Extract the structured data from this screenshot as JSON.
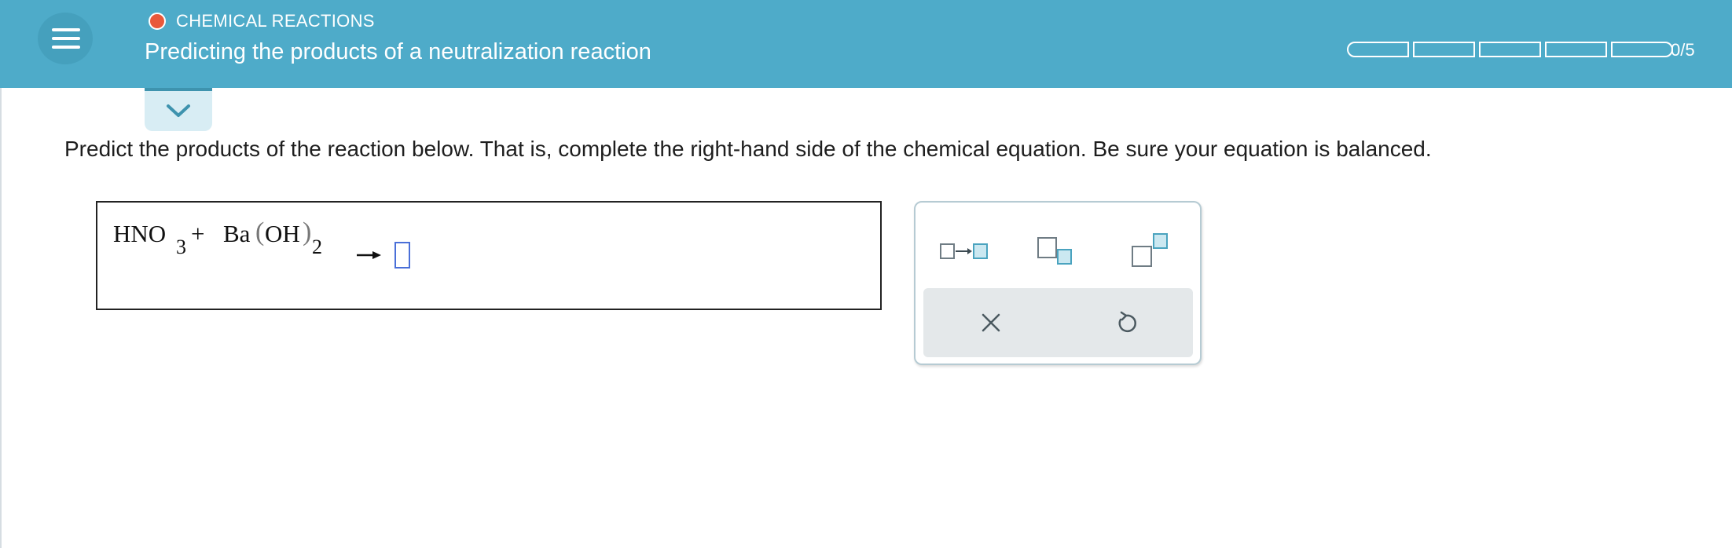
{
  "header": {
    "topic": "CHEMICAL REACTIONS",
    "title": "Predicting the products of a neutralization reaction",
    "progress_text": "0/5",
    "progress_value": 0,
    "progress_segments": 5
  },
  "instructions": "Predict the products of the reaction below. That is, complete the right-hand side of the chemical equation. Be sure your equation is balanced.",
  "equation": {
    "r1_main": "HNO",
    "r1_sub": "3",
    "plus": "+",
    "r2_main": "Ba",
    "r2_open": "(",
    "r2_group": "OH",
    "r2_close": ")",
    "r2_sub": "2"
  },
  "toolbar": {
    "tools": [
      "reaction-arrow-icon",
      "subscript-icon",
      "superscript-icon"
    ],
    "actions": [
      "clear-icon",
      "undo-icon"
    ]
  },
  "colors": {
    "header": "#4eabc9",
    "status_dot": "#e8583b",
    "answer_slot": "#4a6fd8",
    "tool_accent": "#5fb6cf"
  }
}
